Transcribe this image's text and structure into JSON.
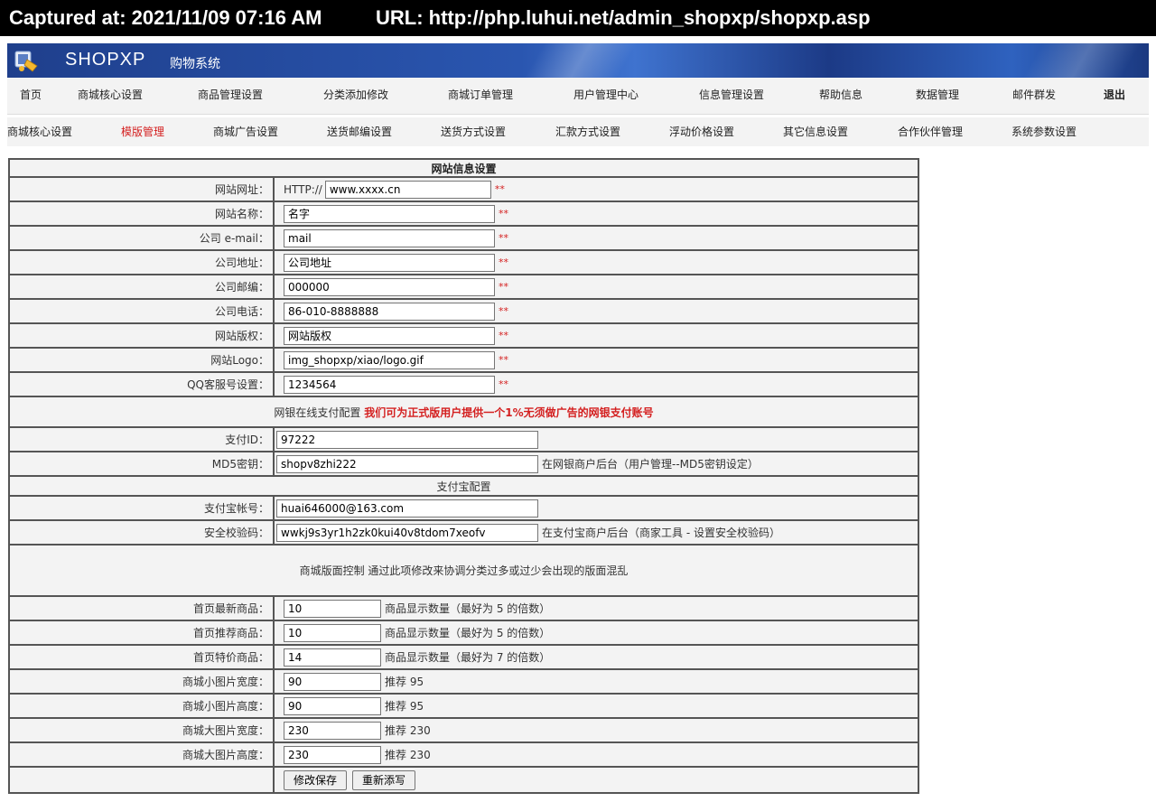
{
  "capture": {
    "time_label": "Captured at: 2021/11/09 07:16 AM",
    "url_label": "URL: http://php.luhui.net/admin_shopxp/shopxp.asp"
  },
  "banner": {
    "brand": "SHOPXP",
    "subtitle": "购物系统"
  },
  "nav_primary": [
    "首页",
    "商城核心设置",
    "商品管理设置",
    "分类添加修改",
    "商城订单管理",
    "用户管理中心",
    "信息管理设置",
    "帮助信息",
    "数据管理",
    "邮件群发",
    "退出"
  ],
  "nav_secondary": [
    "商城核心设置",
    "模版管理",
    "商城广告设置",
    "送货邮编设置",
    "送货方式设置",
    "汇款方式设置",
    "浮动价格设置",
    "其它信息设置",
    "合作伙伴管理",
    "系统参数设置"
  ],
  "nav_secondary_active": "模版管理",
  "form": {
    "title": "网站信息设置",
    "site": {
      "url_label": "网站网址：",
      "url_prefix": "HTTP://",
      "url_value": "www.xxxx.cn",
      "name_label": "网站名称：",
      "name_value": "名字",
      "email_label": "公司 e-mail：",
      "email_value": "mail",
      "address_label": "公司地址：",
      "address_value": "公司地址",
      "zip_label": "公司邮编：",
      "zip_value": "000000",
      "phone_label": "公司电话：",
      "phone_value": "86-010-8888888",
      "copyright_label": "网站版权：",
      "copyright_value": "网站版权",
      "logo_label": "网站Logo：",
      "logo_value": "img_shopxp/xiao/logo.gif",
      "qq_label": "QQ客服号设置：",
      "qq_value": "1234564",
      "required_mark": "**"
    },
    "bank": {
      "header": "网银在线支付配置",
      "header_note": "我们可为正式版用户提供一个1%无须做广告的网银支付账号",
      "pay_id_label": "支付ID：",
      "pay_id_value": "97222",
      "md5_label": "MD5密钥：",
      "md5_value": "shopv8zhi222",
      "md5_hint": "在网银商户后台（用户管理--MD5密钥设定）"
    },
    "alipay": {
      "header": "支付宝配置",
      "account_label": "支付宝帐号：",
      "account_value": "huai646000@163.com",
      "key_label": "安全校验码：",
      "key_value": "wwkj9s3yr1h2zk0kui40v8tdom7xeofv",
      "key_hint": "在支付宝商户后台（商家工具 - 设置安全校验码）"
    },
    "layout": {
      "header": "商城版面控制 通过此项修改来协调分类过多或过少会出现的版面混乱",
      "latest_label": "首页最新商品：",
      "latest_value": "10",
      "latest_hint": "商品显示数量（最好为 5 的倍数）",
      "recommend_label": "首页推荐商品：",
      "recommend_value": "10",
      "recommend_hint": "商品显示数量（最好为 5 的倍数）",
      "special_label": "首页特价商品：",
      "special_value": "14",
      "special_hint": "商品显示数量（最好为 7 的倍数）",
      "small_w_label": "商城小图片宽度：",
      "small_w_value": "90",
      "small_w_hint": "推荐 95",
      "small_h_label": "商城小图片高度：",
      "small_h_value": "90",
      "small_h_hint": "推荐 95",
      "big_w_label": "商城大图片宽度：",
      "big_w_value": "230",
      "big_w_hint": "推荐 230",
      "big_h_label": "商城大图片高度：",
      "big_h_value": "230",
      "big_h_hint": "推荐 230"
    },
    "buttons": {
      "save": "修改保存",
      "reset": "重新添写"
    }
  }
}
